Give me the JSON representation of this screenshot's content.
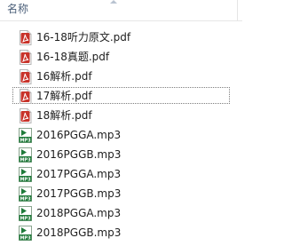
{
  "header": {
    "name_column": "名称"
  },
  "files": [
    {
      "name": "16-18听力原文.pdf",
      "type": "pdf",
      "focused": false
    },
    {
      "name": "16-18真题.pdf",
      "type": "pdf",
      "focused": false
    },
    {
      "name": "16解析.pdf",
      "type": "pdf",
      "focused": false
    },
    {
      "name": "17解析.pdf",
      "type": "pdf",
      "focused": true
    },
    {
      "name": "18解析.pdf",
      "type": "pdf",
      "focused": false
    },
    {
      "name": "2016PGGA.mp3",
      "type": "mp3",
      "focused": false
    },
    {
      "name": "2016PGGB.mp3",
      "type": "mp3",
      "focused": false
    },
    {
      "name": "2017PGGA.mp3",
      "type": "mp3",
      "focused": false
    },
    {
      "name": "2017PGGB.mp3",
      "type": "mp3",
      "focused": false
    },
    {
      "name": "2018PGGA.mp3",
      "type": "mp3",
      "focused": false
    },
    {
      "name": "2018PGGB.mp3",
      "type": "mp3",
      "focused": false
    }
  ],
  "icons": {
    "pdf": "pdf-file-icon",
    "mp3": "mp3-file-icon"
  },
  "colors": {
    "pdf_red": "#c8332a",
    "mp3_green": "#1f7a3a",
    "header_text": "#4c607a"
  }
}
